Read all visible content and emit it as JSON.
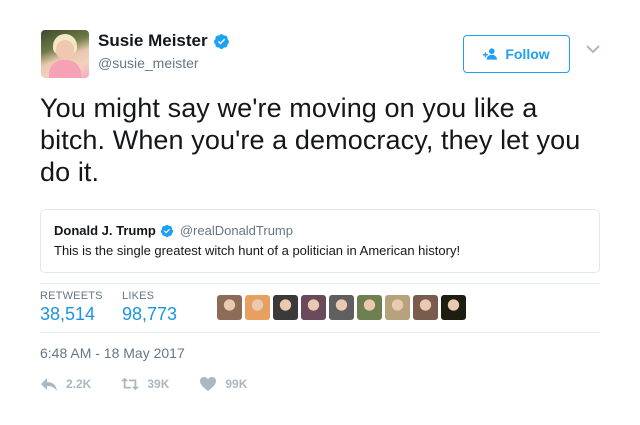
{
  "author": {
    "display_name": "Susie Meister",
    "handle": "@susie_meister"
  },
  "follow_button": {
    "label": "Follow"
  },
  "tweet": {
    "text": "You might say we're moving on you like a bitch. When you're a democracy, they let you do it."
  },
  "quoted": {
    "name": "Donald J. Trump",
    "handle": "@realDonaldTrump",
    "text": "This is the single greatest witch hunt of a politician in American history!"
  },
  "stats": {
    "retweets_label": "RETWEETS",
    "retweets_value": "38,514",
    "likes_label": "LIKES",
    "likes_value": "98,773"
  },
  "liker_avatars": [
    {
      "color": "#8c6b58"
    },
    {
      "color": "#e8a060"
    },
    {
      "color": "#3a3a3a"
    },
    {
      "color": "#6a4a5a"
    },
    {
      "color": "#5f5f5f"
    },
    {
      "color": "#6e7f50"
    },
    {
      "color": "#b7a27e"
    },
    {
      "color": "#7a5c4e"
    },
    {
      "color": "#1d1d10"
    }
  ],
  "timestamp": "6:48 AM - 18 May 2017",
  "actions": {
    "reply_count": "2.2K",
    "retweet_count": "39K",
    "like_count": "99K"
  },
  "colors": {
    "accent": "#1da1f2",
    "stat_value": "#1b95e0",
    "muted": "#657786",
    "action_icon": "#aab8c2"
  }
}
